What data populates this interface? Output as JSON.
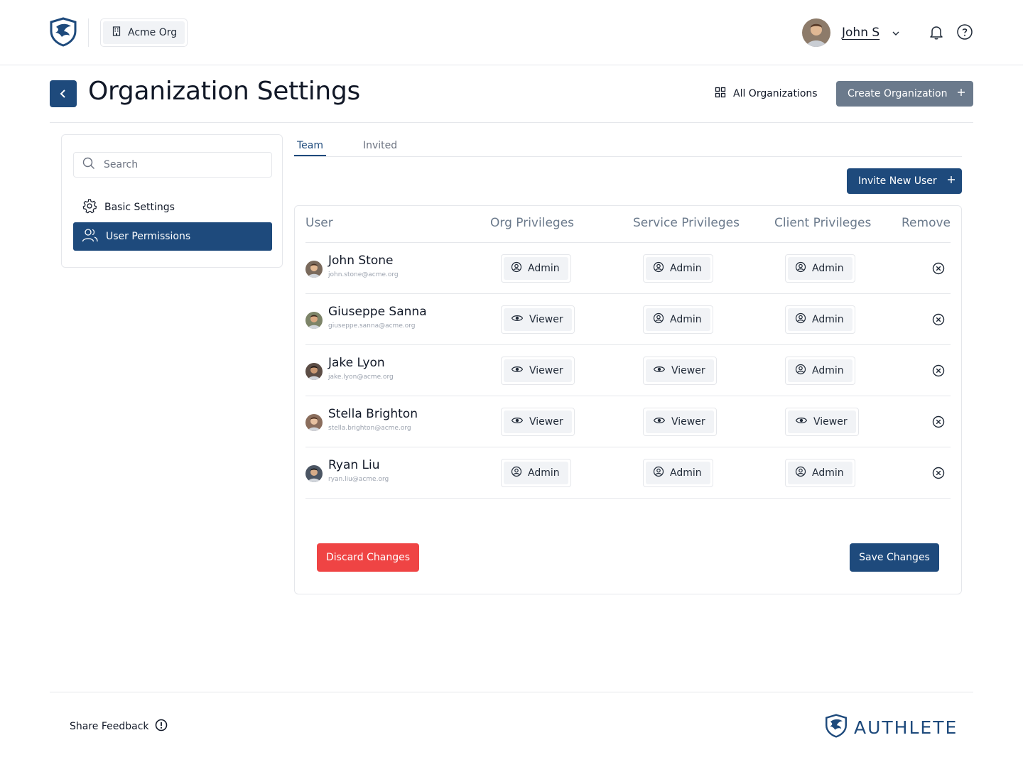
{
  "header": {
    "org_name": "Acme Org",
    "user_name": "John S"
  },
  "page": {
    "title": "Organization Settings",
    "all_orgs_label": "All Organizations",
    "create_org_label": "Create Organization"
  },
  "sidebar": {
    "search_placeholder": "Search",
    "items": [
      {
        "label": "Basic Settings",
        "icon": "gear-icon",
        "active": false
      },
      {
        "label": "User Permissions",
        "icon": "users-icon",
        "active": true
      }
    ]
  },
  "tabs": [
    {
      "label": "Team",
      "active": true
    },
    {
      "label": "Invited",
      "active": false
    }
  ],
  "invite_label": "Invite New User",
  "table": {
    "headers": [
      "User",
      "Org Privileges",
      "Service Privileges",
      "Client Privileges",
      "Remove"
    ],
    "rows": [
      {
        "name": "John Stone",
        "email": "john.stone@acme.org",
        "org": "Admin",
        "service": "Admin",
        "client": "Admin"
      },
      {
        "name": "Giuseppe Sanna",
        "email": "giuseppe.sanna@acme.org",
        "org": "Viewer",
        "service": "Admin",
        "client": "Admin"
      },
      {
        "name": "Jake Lyon",
        "email": "jake.lyon@acme.org",
        "org": "Viewer",
        "service": "Viewer",
        "client": "Admin"
      },
      {
        "name": "Stella Brighton",
        "email": "stella.brighton@acme.org",
        "org": "Viewer",
        "service": "Viewer",
        "client": "Viewer"
      },
      {
        "name": "Ryan Liu",
        "email": "ryan.liu@acme.org",
        "org": "Admin",
        "service": "Admin",
        "client": "Admin"
      }
    ]
  },
  "actions": {
    "discard_label": "Discard Changes",
    "save_label": "Save Changes"
  },
  "footer": {
    "feedback_label": "Share Feedback",
    "brand": "AUTHLETE"
  },
  "colors": {
    "primary": "#1e4a7c",
    "danger": "#ef4444",
    "muted_button": "#6b7a8c"
  }
}
